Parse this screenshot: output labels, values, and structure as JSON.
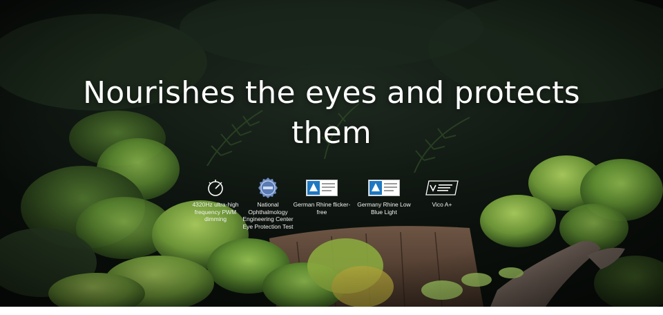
{
  "hero": {
    "title": "Nourishes the eyes and protects them"
  },
  "features": [
    {
      "icon": "pwm-dimming-icon",
      "label": "4320Hz ultra-high frequency PWM dimming"
    },
    {
      "icon": "eye-protection-badge-icon",
      "label": "National Ophthalmology Engineering Center Eye Protection Test"
    },
    {
      "icon": "tuv-rheinland-flicker-icon",
      "label": "German Rhine flicker-free"
    },
    {
      "icon": "tuv-rheinland-blue-light-icon",
      "label": "Germany Rhine Low Blue Light"
    },
    {
      "icon": "vico-certification-icon",
      "label": "Vico A+"
    }
  ],
  "colors": {
    "background_dark": "#0a0f0b",
    "moss_green": "#6f9a3c",
    "bark_brown": "#5a4434",
    "text": "#ffffff"
  }
}
